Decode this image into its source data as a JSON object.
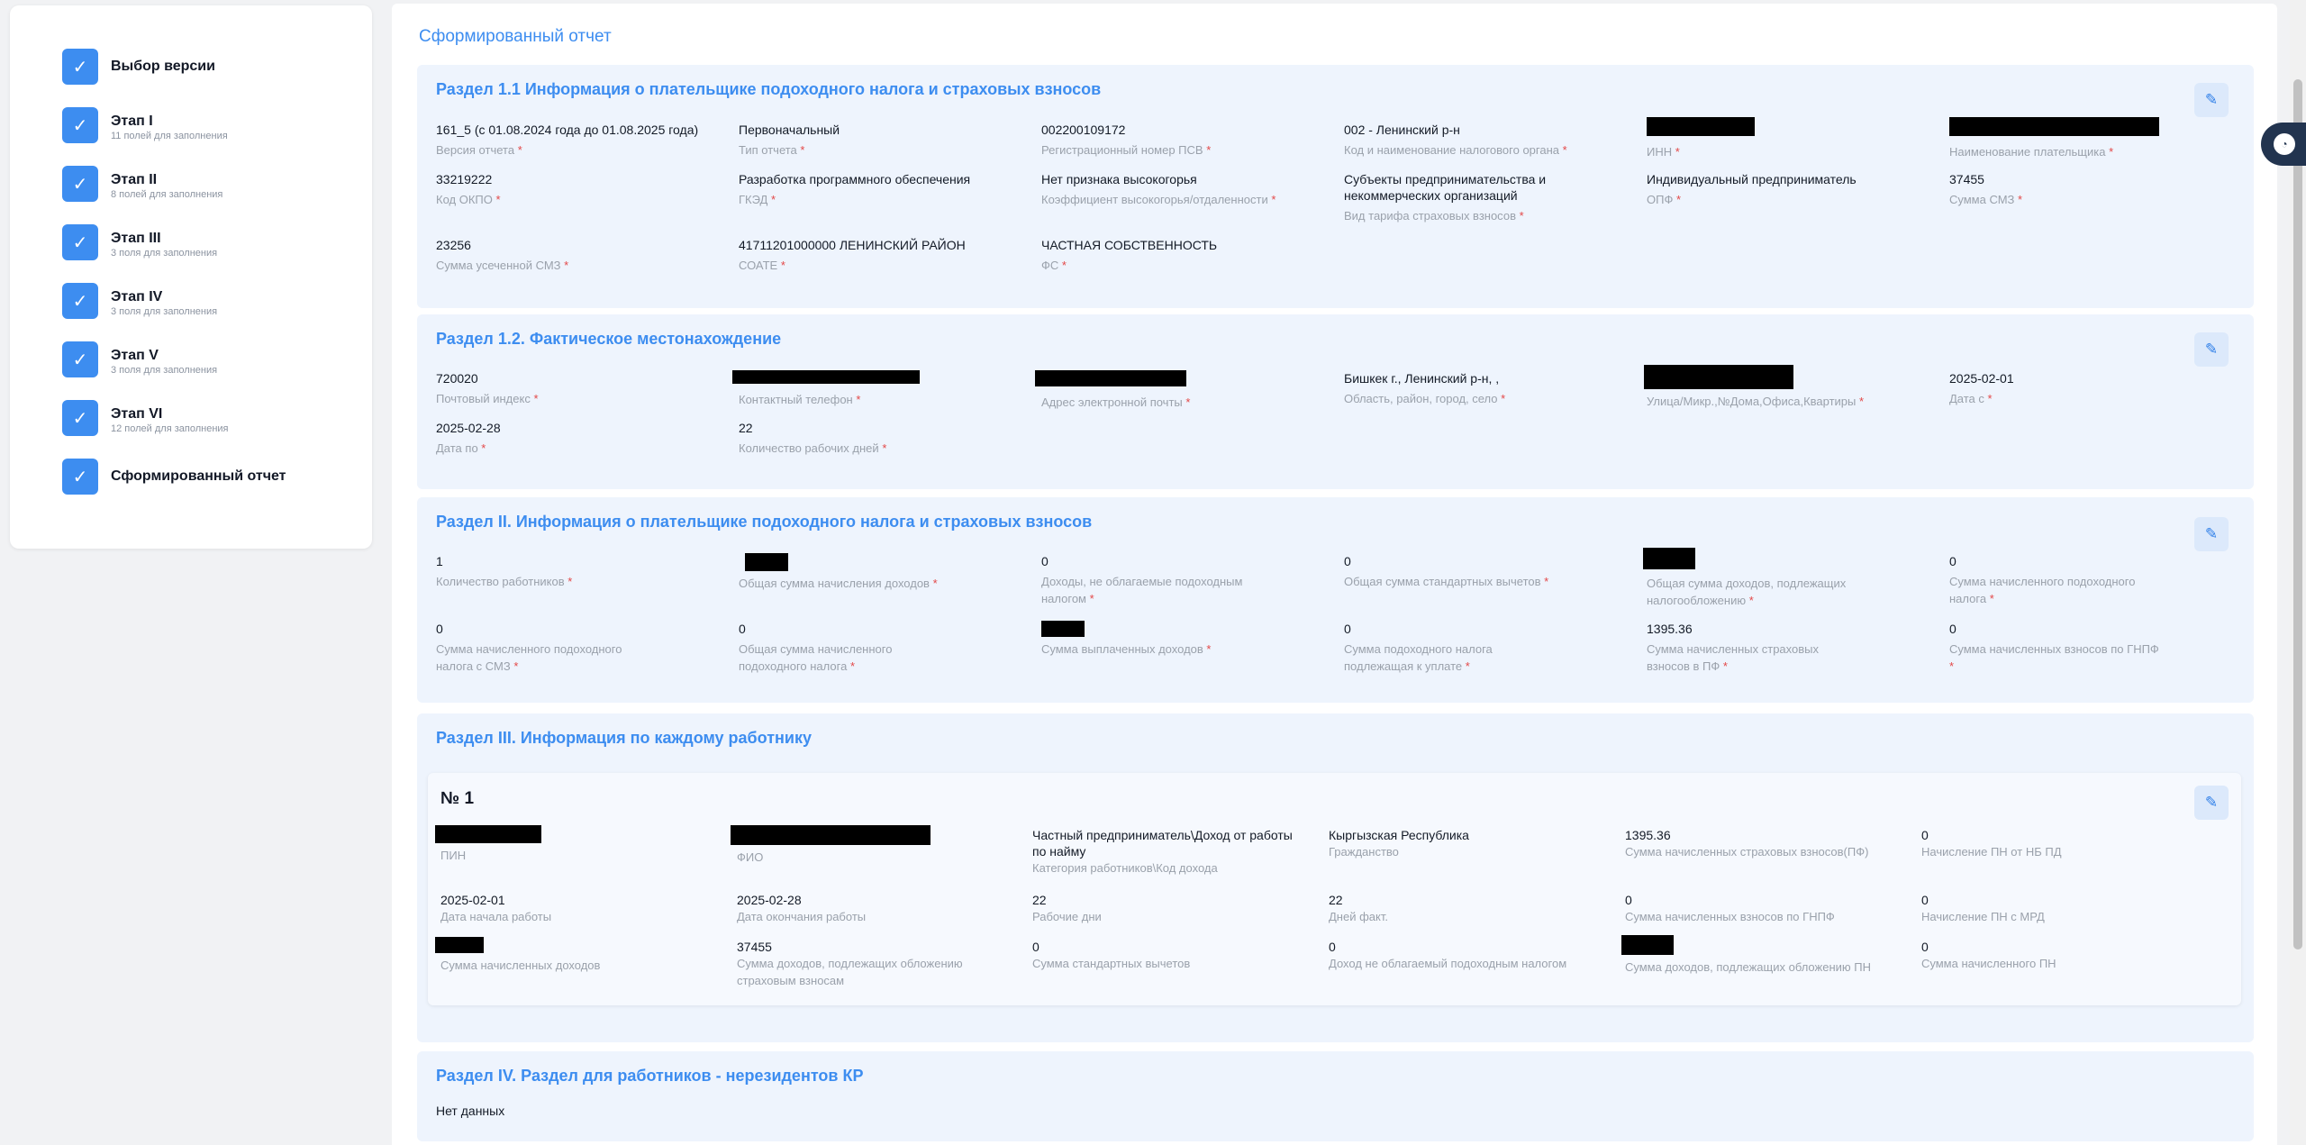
{
  "sidebar": {
    "steps": [
      {
        "title": "Выбор версии",
        "sub": ""
      },
      {
        "title": "Этап I",
        "sub": "11 полей для заполнения"
      },
      {
        "title": "Этап II",
        "sub": "8 полей для заполнения"
      },
      {
        "title": "Этап III",
        "sub": "3 поля для заполнения"
      },
      {
        "title": "Этап IV",
        "sub": "3 поля для заполнения"
      },
      {
        "title": "Этап V",
        "sub": "3 поля для заполнения"
      },
      {
        "title": "Этап VI",
        "sub": "12 полей для заполнения"
      },
      {
        "title": "Сформированный отчет",
        "sub": ""
      }
    ]
  },
  "main": {
    "title": "Сформированный отчет",
    "required_mark": "*",
    "section1": {
      "title": "Раздел 1.1 Информация о плательщике подоходного налога и страховых взносов",
      "fields": [
        {
          "value": "161_5 (с 01.08.2024 года до 01.08.2025 года)",
          "label": "Версия отчета"
        },
        {
          "value": "Первоначальный",
          "label": "Тип отчета"
        },
        {
          "value": "002200109172",
          "label": "Регистрационный номер ПСВ"
        },
        {
          "value": "002 - Ленинский р-н",
          "label": "Код и наименование налогового органа"
        },
        {
          "value": "",
          "label": "ИНН"
        },
        {
          "value": "",
          "label": "Наименование плательщика"
        },
        {
          "value": "33219222",
          "label": "Код ОКПО"
        },
        {
          "value": "Разработка программного обеспечения",
          "label": "ГКЭД"
        },
        {
          "value": "Нет признака высокогорья",
          "label": "Коэффициент высокогорья/отдаленности"
        },
        {
          "value": "Субъекты предпринимательства и некоммерческих организаций",
          "label": "Вид тарифа страховых взносов"
        },
        {
          "value": "Индивидуальный предприниматель",
          "label": "ОПФ"
        },
        {
          "value": "37455",
          "label": "Сумма СМЗ"
        },
        {
          "value": "23256",
          "label": "Сумма усеченной СМЗ"
        },
        {
          "value": "41711201000000 ЛЕНИНСКИЙ РАЙОН",
          "label": "СОАТЕ"
        },
        {
          "value": "ЧАСТНАЯ СОБСТВЕННОСТЬ",
          "label": "ФС"
        }
      ]
    },
    "section2": {
      "title": "Раздел 1.2. Фактическое местонахождение",
      "fields": [
        {
          "value": "720020",
          "label": "Почтовый индекс"
        },
        {
          "value": "",
          "label": "Контактный телефон"
        },
        {
          "value": "",
          "label": "Адрес электронной почты"
        },
        {
          "value": "Бишкек г., Ленинский р-н, ,",
          "label": "Область, район, город, село"
        },
        {
          "value": "",
          "label": "Улица/Микр.,№Дома,Офиса,Квартиры"
        },
        {
          "value": "2025-02-01",
          "label": "Дата с"
        },
        {
          "value": "2025-02-28",
          "label": "Дата по"
        },
        {
          "value": "22",
          "label": "Количество рабочих дней"
        }
      ]
    },
    "section3": {
      "title": "Раздел II. Информация о плательщике подоходного налога и страховых взносов",
      "fields": [
        {
          "value": "1",
          "label": "Количество работников"
        },
        {
          "value": "",
          "label": "Общая сумма начисления доходов"
        },
        {
          "value": "0",
          "label": "Доходы, не облагаемые подоходным налогом"
        },
        {
          "value": "0",
          "label": "Общая сумма стандартных вычетов"
        },
        {
          "value": "",
          "label": "Общая сумма доходов, подлежащих налогообложению"
        },
        {
          "value": "0",
          "label": "Сумма начисленного подоходного налога"
        },
        {
          "value": "0",
          "label": "Сумма начисленного подоходного налога с СМЗ"
        },
        {
          "value": "0",
          "label": "Общая сумма начисленного подоходного налога"
        },
        {
          "value": "",
          "label": "Сумма выплаченных доходов"
        },
        {
          "value": "0",
          "label": "Сумма подоходного налога подлежащая к уплате"
        },
        {
          "value": "1395.36",
          "label": "Сумма начисленных страховых взносов в ПФ"
        },
        {
          "value": "0",
          "label": "Сумма начисленных взносов по ГНПФ"
        }
      ]
    },
    "section4": {
      "title": "Раздел III. Информация по каждому работнику",
      "card_title": "№ 1",
      "fields": [
        {
          "value": "",
          "label": "ПИН"
        },
        {
          "value": "",
          "label": "ФИО"
        },
        {
          "value": "Частный предприниматель\\Доход от работы по найму",
          "label": "Категория работников\\Код дохода"
        },
        {
          "value": "Кыргызская Республика",
          "label": "Гражданство"
        },
        {
          "value": "1395.36",
          "label": "Сумма начисленных страховых взносов(ПФ)"
        },
        {
          "value": "0",
          "label": "Начисление ПН от НБ ПД"
        },
        {
          "value": "2025-02-01",
          "label": "Дата начала работы"
        },
        {
          "value": "2025-02-28",
          "label": "Дата окончания работы"
        },
        {
          "value": "22",
          "label": "Рабочие дни"
        },
        {
          "value": "22",
          "label": "Дней факт."
        },
        {
          "value": "0",
          "label": "Сумма начисленных взносов по ГНПФ"
        },
        {
          "value": "0",
          "label": "Начисление ПН с МРД"
        },
        {
          "value": "",
          "label": "Сумма начисленных доходов"
        },
        {
          "value": "37455",
          "label": "Сумма доходов, подлежащих обложению страховым взносам"
        },
        {
          "value": "0",
          "label": "Сумма стандартных вычетов"
        },
        {
          "value": "0",
          "label": "Доход не облагаемый подоходным налогом"
        },
        {
          "value": "",
          "label": "Сумма доходов, подлежащих обложению ПН"
        },
        {
          "value": "0",
          "label": "Сумма начисленного ПН"
        }
      ]
    },
    "section5": {
      "title": "Раздел IV. Раздел для работников - нерезидентов КР",
      "empty_text": "Нет данных"
    }
  },
  "icons": {
    "check": "check-icon",
    "edit": "pencil-icon",
    "chat": "chat-icon"
  },
  "colors": {
    "accent": "#3d8df0",
    "section_bg": "#eef4fd",
    "required": "#e34848"
  }
}
